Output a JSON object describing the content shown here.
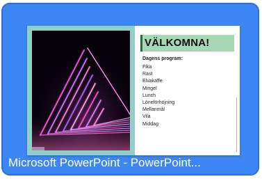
{
  "window_tile": {
    "caption": "Microsoft PowerPoint - PowerPoint...",
    "accent_color": "#3d86f5"
  },
  "slide": {
    "title": "VÄLKOMNA!",
    "program_heading": "Dagens program:",
    "program_items": [
      "Fika",
      "Rast",
      "Elvakaffe",
      "Mingel",
      "Lunch",
      "Löneförhöjning",
      "Mellanmål",
      "Vila",
      "Middag"
    ],
    "image": "neon-light-staircase"
  }
}
